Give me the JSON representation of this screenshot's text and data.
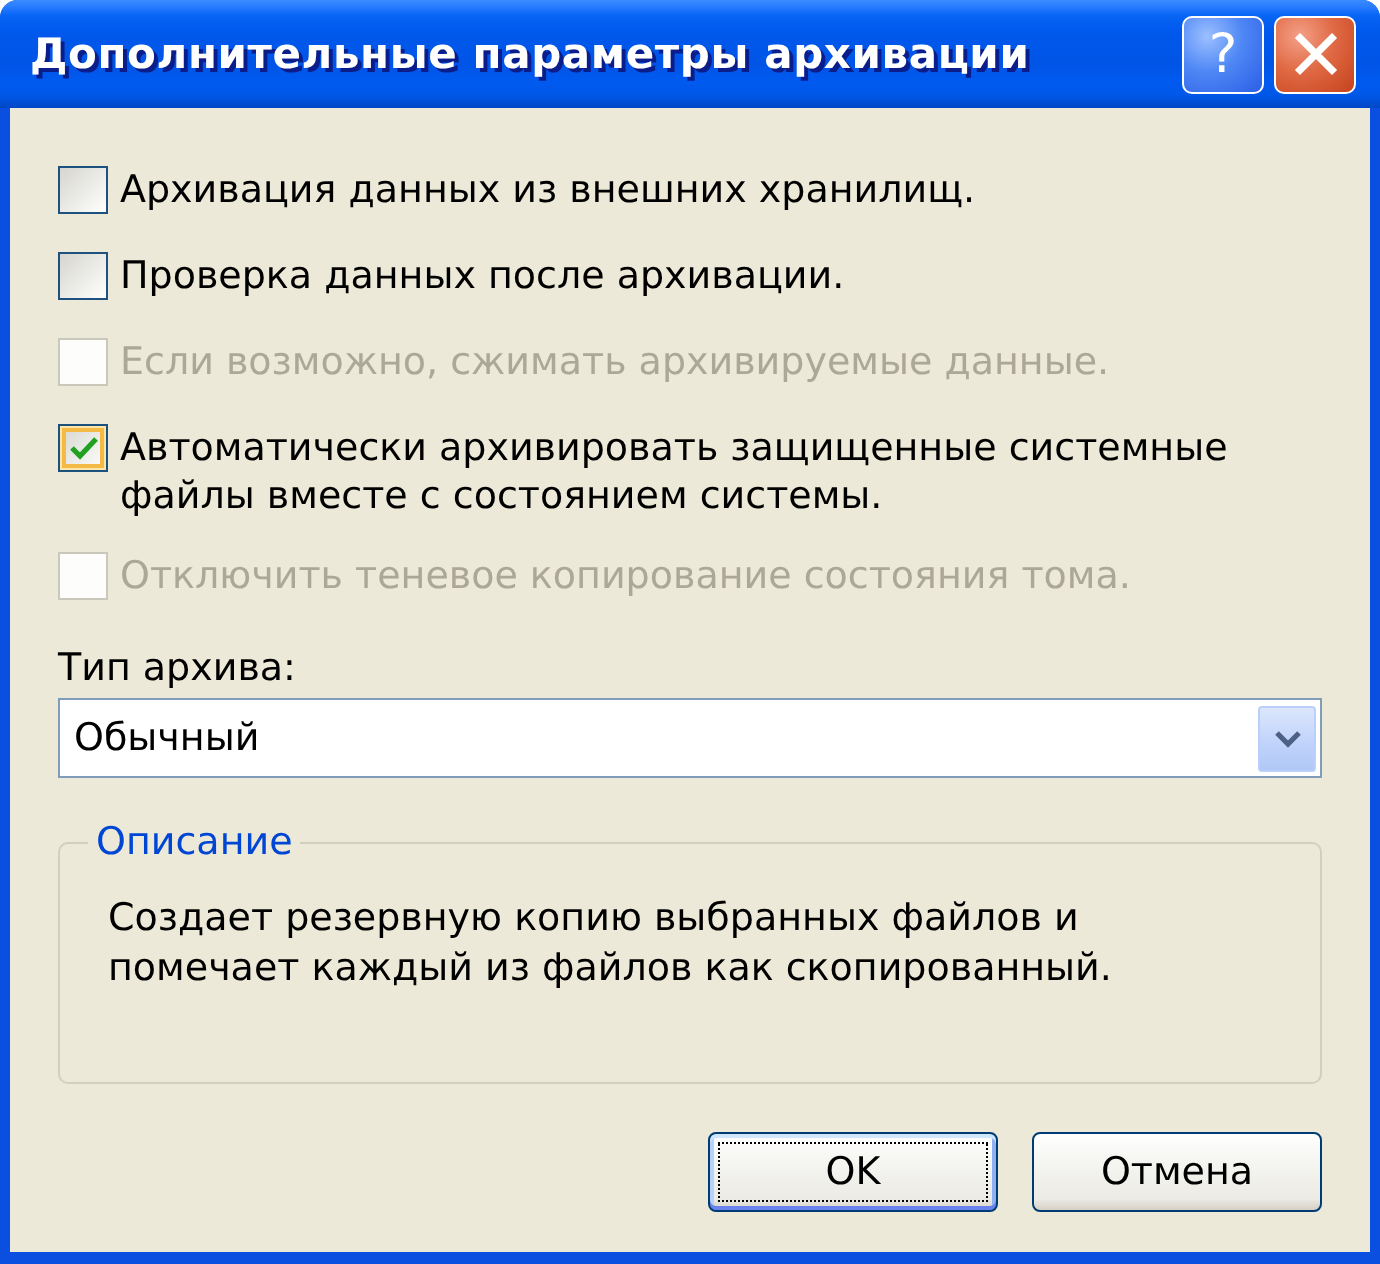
{
  "window": {
    "title": "Дополнительные параметры архивации",
    "buttons": [
      {
        "kind": "help",
        "label": "?"
      },
      {
        "kind": "close"
      }
    ]
  },
  "options": [
    {
      "label": "Архивация данных из внешних хранилищ.",
      "checked": false,
      "disabled": false,
      "hover": false
    },
    {
      "label": "Проверка данных после архивации.",
      "checked": false,
      "disabled": false,
      "hover": false
    },
    {
      "label": "Если возможно, сжимать архивируемые данные.",
      "checked": false,
      "disabled": true,
      "hover": false
    },
    {
      "label": "Автоматически архивировать защищенные системные файлы вместе с состоянием системы.",
      "checked": true,
      "disabled": false,
      "hover": true
    },
    {
      "label": "Отключить теневое копирование состояния тома.",
      "checked": false,
      "disabled": true,
      "hover": false
    }
  ],
  "archive_type": {
    "label": "Тип архива:",
    "value": "Обычный"
  },
  "description": {
    "title": "Описание",
    "text": "Создает резервную копию выбранных файлов и помечает каждый из файлов как скопированный."
  },
  "buttons": [
    {
      "label": "OK",
      "default": true
    },
    {
      "label": "Отмена",
      "default": false
    }
  ]
}
